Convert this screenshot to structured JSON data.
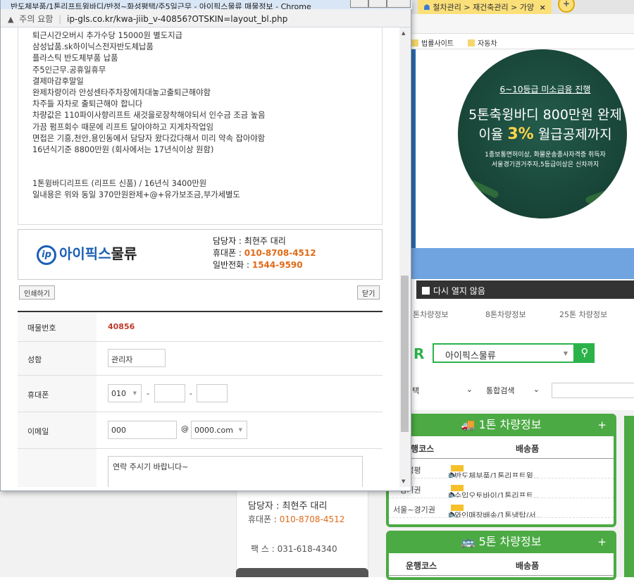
{
  "background": {
    "tab_title": "철차관리 > 재건축관리 > 가양",
    "tab_close": "×",
    "new_tab": "+",
    "bookmarks": [
      "법률사이트",
      "자동차"
    ],
    "hero": {
      "line1": "6~10등급 미소금융 진행",
      "line2": "5톤축윙바디 800만원 완제",
      "line3_pre": "이율 ",
      "line3_rate": "3%",
      "line3_post": " 월급공제까지",
      "note1": "1종보통면허이상, 화물운송종사자격증 취득자",
      "note2": "서울경기권거주자,5등급이상은 신차까지"
    },
    "categories": [
      "톤차량정보",
      "8톤차량정보",
      "25톤 차량정보"
    ],
    "search_brand": "R",
    "search_value": "아이픽스물류",
    "search_icon": "search-icon",
    "filter1": "택",
    "filter2": "통합검색",
    "panel1": {
      "title": "1톤 차량정보",
      "plus": "+",
      "col1": "운행코스",
      "col2": "배송품",
      "rows": [
        {
          "route": "~화성평",
          "item": "* 반도체부품/1톤리프트윙.."
        },
        {
          "route": "~경기권",
          "item": "* 수입오토바이/1톤리프트.."
        },
        {
          "route": "서울~경기권",
          "item": "* 와인매장배송/1톤냉탑/서.."
        }
      ]
    },
    "panel2": {
      "title": "5톤 차량정보",
      "plus": "+",
      "col1": "운행코스",
      "col2": "배송품"
    },
    "contact": {
      "manager": "담당자 : 최현주 대리",
      "phone_label": "휴대폰 : ",
      "phone": "010-8708-4512",
      "fax": "팩 스 : 031-618-4340"
    },
    "no_show_label": "다시 열지 않음"
  },
  "popup": {
    "title": "반도체부품/1톤리프트윙바디/반정~화성평택/주5일근무 - 아이픽스물류 매물정보 - Chrome",
    "addr_warning": "주의 요함",
    "url": "ip-gls.co.kr/kwa-jiib_v-40856?OTSKIN=layout_bl.php",
    "desc_lines": [
      "퇴근시간오버시 추가수당 15000원 별도지급",
      "삼성납품.sk하이닉스전자반도체납품",
      "플라스틱 반도체부품 납품",
      "주5인근무.공휴일휴무",
      "결제마감후말일",
      "완제차량이라 안성센타주차장에차대놓고출퇴근해야함",
      "차주들 자차로 출퇴근해야 합니다",
      "차량값은 110파이사향리프트 새것을로장착해야되서 인수금 조금 높음",
      "가끔 펌프회수 때문에 리프트 달아야하고 지게차작업임",
      "면접은 기흥,천안,용인동에서 담당자 왔다갔다해서 미리 약속 잡아야함",
      "16년식기준 8800만원 (회사에서는 17년식이상 원함)"
    ],
    "desc_lines2": [
      "1톤윙바디리프트 (리프트 신품) / 16년식 3400만원",
      "일내용은 위와 동일 370만원완제+@+유가보조금,부가세별도"
    ],
    "logo_mark": "ip",
    "logo_text_blue": "아이픽스",
    "logo_text_dark": "물류",
    "manager": "담당자 : 최현주 대리",
    "mobile_label": "휴대폰 : ",
    "mobile": "010-8708-4512",
    "tel_label": "일반전화 : ",
    "tel": "1544-9590",
    "print_btn": "인쇄하기",
    "close_btn": "닫기",
    "form": {
      "listing_no_label": "매물번호",
      "listing_no": "40856",
      "name_label": "성함",
      "name_value": "관리자",
      "phone_label": "휴대폰",
      "phone_prefix": "010",
      "dash": "-",
      "email_label": "이메일",
      "email_id": "000",
      "at": "@",
      "email_domain": "0000.com",
      "message": "연락 주시기 바랍니다~"
    }
  }
}
